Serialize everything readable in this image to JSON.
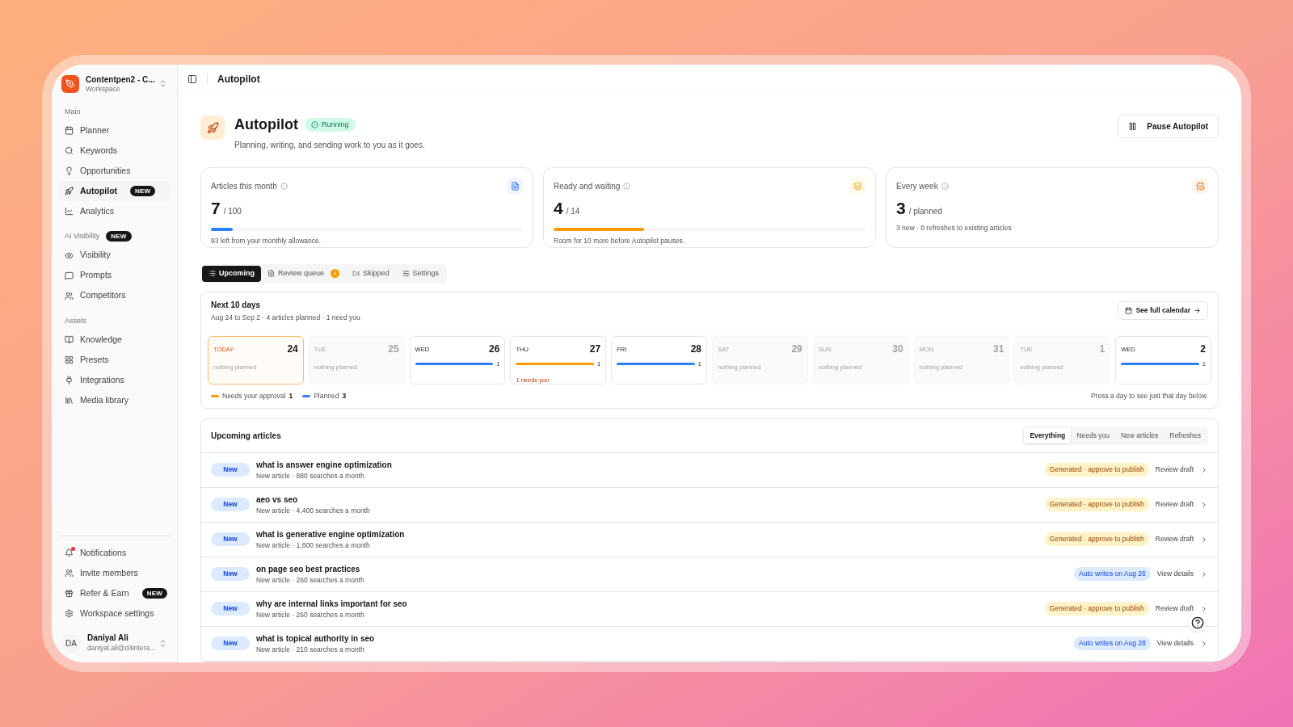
{
  "workspace": {
    "name": "Contentpen2 - C...",
    "subtitle": "Workspace"
  },
  "sidebar": {
    "sections": [
      {
        "label": "Main",
        "items": [
          {
            "label": "Planner",
            "selected": false
          },
          {
            "label": "Keywords",
            "selected": false
          },
          {
            "label": "Opportunities",
            "selected": false
          },
          {
            "label": "Autopilot",
            "selected": true,
            "badge": "NEW"
          },
          {
            "label": "Analytics",
            "selected": false
          }
        ]
      },
      {
        "label": "AI Visibility",
        "badge": "NEW",
        "items": [
          {
            "label": "Visibility",
            "selected": false
          },
          {
            "label": "Prompts",
            "selected": false
          },
          {
            "label": "Competitors",
            "selected": false
          }
        ]
      },
      {
        "label": "Assets",
        "items": [
          {
            "label": "Knowledge",
            "selected": false
          },
          {
            "label": "Presets",
            "selected": false
          },
          {
            "label": "Integrations",
            "selected": false
          },
          {
            "label": "Media library",
            "selected": false
          }
        ]
      }
    ],
    "bottom_items": [
      {
        "label": "Notifications",
        "unread": true
      },
      {
        "label": "Invite members",
        "unread": false
      },
      {
        "label": "Refer & Earn",
        "unread": false,
        "badge": "NEW"
      },
      {
        "label": "Workspace settings",
        "unread": false
      }
    ],
    "user": {
      "initials": "DA",
      "name": "Daniyal Ali",
      "email": "daniyal.ali@d4intera..."
    }
  },
  "header": {
    "title": "Autopilot"
  },
  "page": {
    "title": "Autopilot",
    "status": "Running",
    "subtitle": "Planning, writing, and sending work to you as it goes.",
    "pause_button": "Pause Autopilot"
  },
  "stats": [
    {
      "title": "Articles this month",
      "value": "7",
      "unit": "/ 100",
      "level": 0.07,
      "note": "93 left from your monthly allowance."
    },
    {
      "title": "Ready and waiting",
      "value": "4",
      "unit": "/ 14",
      "level": 0.29,
      "note": "Room for 10 more before Autopilot pauses."
    },
    {
      "title": "Every week",
      "value": "3",
      "unit": "/ planned",
      "note": "3 new · 0 refreshes to existing articles"
    }
  ],
  "tabs": [
    {
      "label": "Upcoming",
      "selected": true
    },
    {
      "label": "Review queue",
      "selected": false,
      "badge": "4"
    },
    {
      "label": "Skipped",
      "selected": false
    },
    {
      "label": "Settings",
      "selected": false
    }
  ],
  "calendar": {
    "title": "Next 10 days",
    "subtitle": "Aug 24 to Sep 2 · 4 articles planned · 1 need you",
    "button": "See full calendar",
    "days": [
      {
        "weekday": "TODAY",
        "date": "24",
        "today": true,
        "kind": "empty",
        "text": "nothing planned"
      },
      {
        "weekday": "TUE",
        "date": "25",
        "today": false,
        "kind": "empty",
        "text": "nothing planned"
      },
      {
        "weekday": "WED",
        "date": "26",
        "today": false,
        "kind": "planned",
        "count": "1"
      },
      {
        "weekday": "THU",
        "date": "27",
        "today": false,
        "kind": "approval",
        "count": "1",
        "text": "1 needs you"
      },
      {
        "weekday": "FRI",
        "date": "28",
        "today": false,
        "kind": "planned",
        "count": "1"
      },
      {
        "weekday": "SAT",
        "date": "29",
        "today": false,
        "kind": "empty",
        "text": "nothing planned"
      },
      {
        "weekday": "SUN",
        "date": "30",
        "today": false,
        "kind": "empty",
        "text": "nothing planned"
      },
      {
        "weekday": "MON",
        "date": "31",
        "today": false,
        "kind": "empty",
        "text": "nothing planned"
      },
      {
        "weekday": "TUE",
        "date": "1",
        "today": false,
        "kind": "empty",
        "text": "nothing planned"
      },
      {
        "weekday": "WED",
        "date": "2",
        "today": false,
        "kind": "planned",
        "count": "1"
      }
    ],
    "legend": [
      {
        "label": "Needs your approval",
        "count": "1",
        "color": "#f59e0b"
      },
      {
        "label": "Planned",
        "count": "3",
        "color": "#3b82f6"
      }
    ],
    "hint": "Press a day to see just that day below."
  },
  "articles": {
    "title": "Upcoming articles",
    "filters": [
      {
        "label": "Everything",
        "selected": true
      },
      {
        "label": "Needs you",
        "selected": false
      },
      {
        "label": "New articles",
        "selected": false
      },
      {
        "label": "Refreshes",
        "selected": false
      }
    ],
    "rows": [
      {
        "badge": "New",
        "title": "what is answer engine optimization",
        "meta": "New article · 880 searches a month",
        "status": "Generated · approve to publish",
        "kind": "generated",
        "action": "Review draft"
      },
      {
        "badge": "New",
        "title": "aeo vs seo",
        "meta": "New article · 4,400 searches a month",
        "status": "Generated · approve to publish",
        "kind": "generated",
        "action": "Review draft"
      },
      {
        "badge": "New",
        "title": "what is generative engine optimization",
        "meta": "New article · 1,600 searches a month",
        "status": "Generated · approve to publish",
        "kind": "generated",
        "action": "Review draft"
      },
      {
        "badge": "New",
        "title": "on page seo best practices",
        "meta": "New article · 260 searches a month",
        "status": "Auto writes on Aug 26",
        "kind": "scheduled",
        "action": "View details"
      },
      {
        "badge": "New",
        "title": "why are internal links important for seo",
        "meta": "New article · 260 searches a month",
        "status": "Generated · approve to publish",
        "kind": "generated",
        "action": "Review draft"
      },
      {
        "badge": "New",
        "title": "what is topical authority in seo",
        "meta": "New article · 210 searches a month",
        "status": "Auto writes on Aug 28",
        "kind": "scheduled",
        "action": "View details"
      }
    ]
  }
}
